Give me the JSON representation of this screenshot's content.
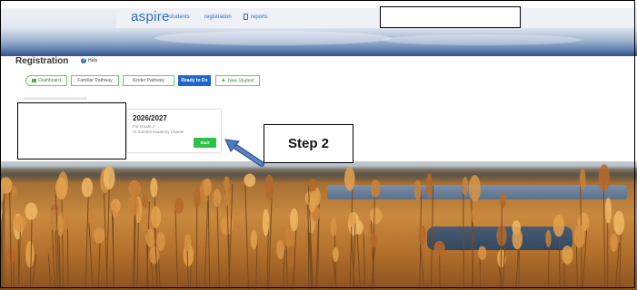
{
  "navbar": {
    "logo": "aspire",
    "links": [
      "students",
      "registration",
      "reports"
    ]
  },
  "header": {
    "title": "Registration",
    "help_label": "Help"
  },
  "breadcrumbs": [
    "Dashboard",
    "Familiar Pathway",
    "Kinder Pathway",
    "Ready to Do",
    "New Student"
  ],
  "card": {
    "year": "2026/2027",
    "grade": "For Grade 2",
    "school": "At Summit Academy Charter",
    "start_label": "Start"
  },
  "annotation": {
    "step_label": "Step 2"
  },
  "colors": {
    "brand_blue": "#2d6fb8",
    "active_tab": "#1f67c8",
    "start_green": "#2fbe4a",
    "arrow_blue": "#3f6fb5"
  }
}
